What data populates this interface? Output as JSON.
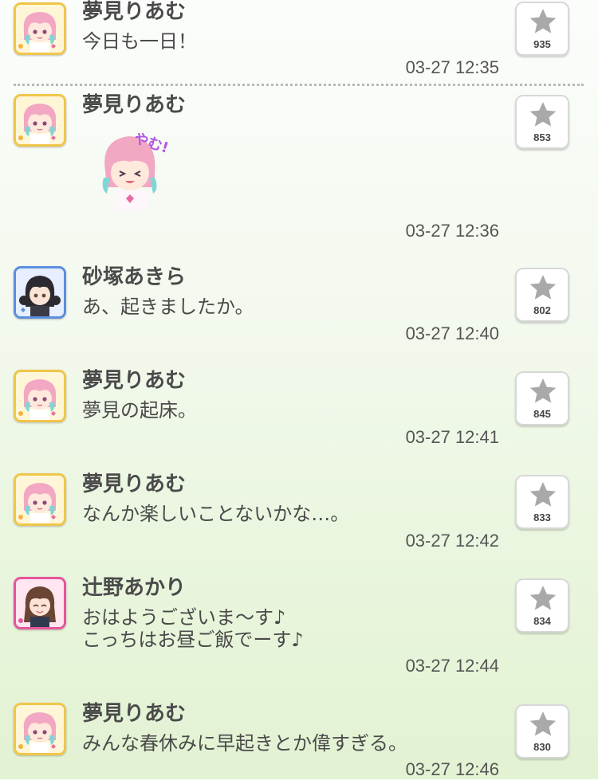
{
  "posts": [
    {
      "name": "夢見りあむ",
      "message": "今日も一日！",
      "time": "03-27 12:35",
      "likes": "935"
    },
    {
      "name": "夢見りあむ",
      "stamp_text": "やむ!",
      "time": "03-27 12:36",
      "likes": "853"
    },
    {
      "name": "砂塚あきら",
      "message": "あ、起きましたか。",
      "time": "03-27 12:40",
      "likes": "802"
    },
    {
      "name": "夢見りあむ",
      "message": "夢見の起床。",
      "time": "03-27 12:41",
      "likes": "845"
    },
    {
      "name": "夢見りあむ",
      "message": "なんか楽しいことないかな…。",
      "time": "03-27 12:42",
      "likes": "833"
    },
    {
      "name": "辻野あかり",
      "message_lines": [
        "おはようございま〜す♪",
        "こっちはお昼ご飯でーす♪"
      ],
      "time": "03-27 12:44",
      "likes": "834"
    },
    {
      "name": "夢見りあむ",
      "message": "みんな春休みに早起きとか偉すぎる。",
      "time": "03-27 12:46",
      "likes": "830"
    }
  ],
  "icons": {
    "like": "star-icon",
    "avatar_riamu": "riamu-avatar",
    "avatar_akira": "akira-avatar",
    "avatar_akari": "akari-avatar"
  },
  "colors": {
    "text": "#4a4a4a",
    "star": "#a9a9a9",
    "gold_frame": "#f0c64a",
    "blue_frame": "#5a8fe0",
    "pink_frame": "#e6559a",
    "stamp_text": "#b255e0"
  }
}
